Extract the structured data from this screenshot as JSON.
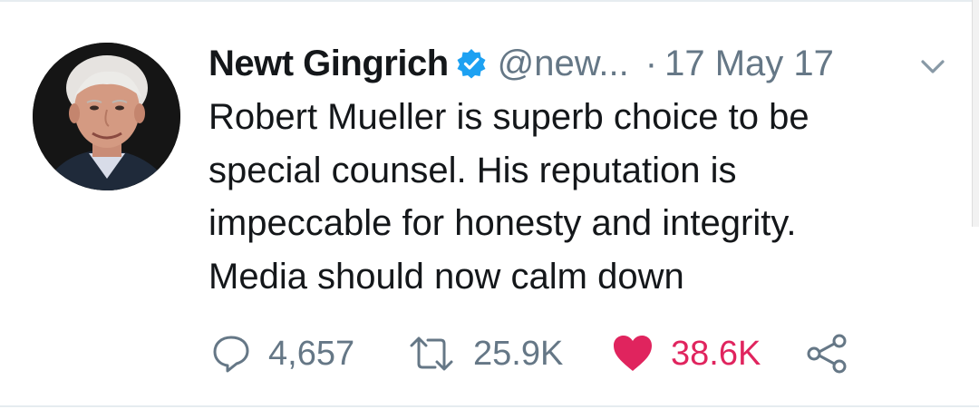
{
  "tweet": {
    "author": {
      "display_name": "Newt Gingrich",
      "handle": "@new...",
      "verified": true,
      "avatar": "profile-photo"
    },
    "separator": "·",
    "date": "17 May 17",
    "text_lines": [
      "Robert Mueller is superb choice to be",
      "special counsel. His reputation is",
      "impeccable for honesty and integrity.",
      "Media should now calm down"
    ],
    "actions": {
      "reply": {
        "icon": "reply-icon",
        "count": "4,657"
      },
      "retweet": {
        "icon": "retweet-icon",
        "count": "25.9K"
      },
      "like": {
        "icon": "heart-icon",
        "count": "38.6K",
        "liked": true
      },
      "share": {
        "icon": "share-icon"
      }
    }
  },
  "colors": {
    "primary_text": "#14171a",
    "secondary_text": "#657786",
    "verified_blue": "#1da1f2",
    "like_red": "#e0245e",
    "divider": "#e6ecf0"
  }
}
